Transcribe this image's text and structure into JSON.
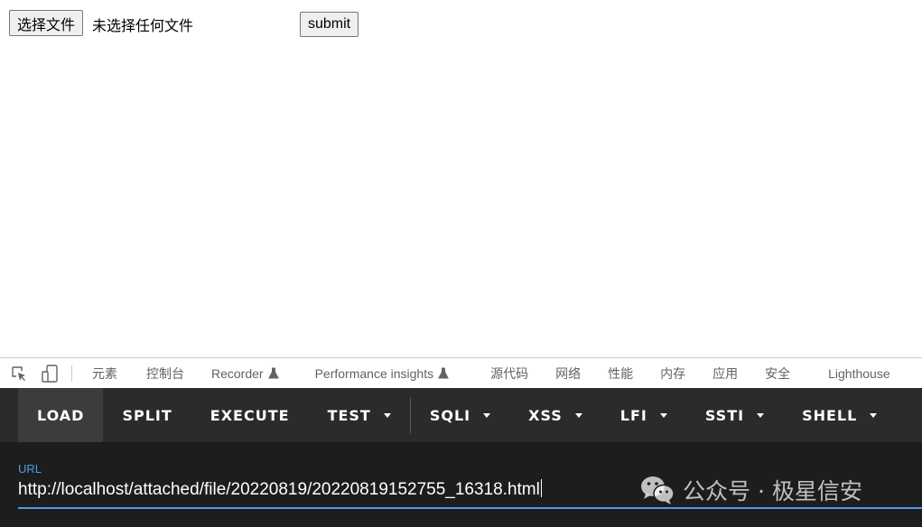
{
  "page": {
    "file_button": "选择文件",
    "file_status": "未选择任何文件",
    "submit_button": "submit"
  },
  "devtools": {
    "tabs": [
      "元素",
      "控制台",
      "Recorder",
      "Performance insights",
      "源代码",
      "网络",
      "性能",
      "内存",
      "应用",
      "安全",
      "Lighthouse"
    ],
    "icons": [
      "inspect-element-icon",
      "device-toolbar-icon",
      "flask-icon"
    ]
  },
  "hackbar": {
    "buttons": [
      "LOAD",
      "SPLIT",
      "EXECUTE",
      "TEST",
      "SQLI",
      "XSS",
      "LFI",
      "SSTI",
      "SHELL"
    ],
    "active": "LOAD",
    "url_label": "URL",
    "url_value": "http://localhost/attached/file/20220819/20220819152755_16318.html"
  },
  "watermark": {
    "text": "公众号 · 极星信安",
    "icon": "wechat-logo"
  },
  "colors": {
    "hackbar_bg": "#2b2b2b",
    "url_bg": "#1d1d1d",
    "accent": "#4c9be8"
  }
}
